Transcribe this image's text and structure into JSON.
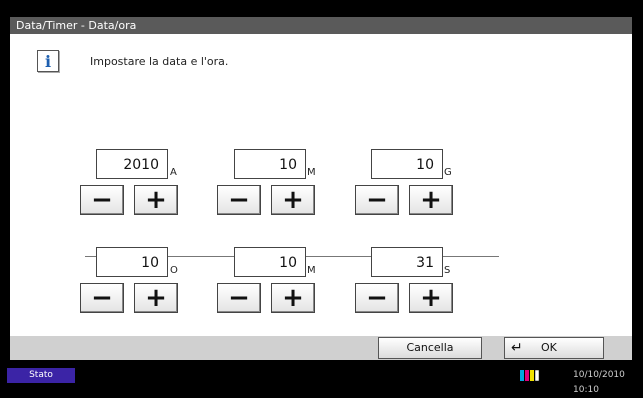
{
  "title": "Data/Timer - Data/ora",
  "message": "Impostare la data e l'ora.",
  "icons": {
    "info": "info-icon",
    "minus": "minus-icon",
    "plus": "plus-icon",
    "enter": "enter-arrow-icon",
    "toner": "toner-status-icon"
  },
  "glyphs": {
    "info": "i",
    "minus": "−",
    "plus": "+",
    "enter": "↵"
  },
  "date": {
    "year": {
      "value": "2010",
      "unit": "A"
    },
    "month": {
      "value": "10",
      "unit": "M"
    },
    "day": {
      "value": "10",
      "unit": "G"
    }
  },
  "time": {
    "hour": {
      "value": "10",
      "unit": "O"
    },
    "minute": {
      "value": "10",
      "unit": "M"
    },
    "second": {
      "value": "31",
      "unit": "S"
    }
  },
  "buttons": {
    "cancel": "Cancella",
    "ok": "OK"
  },
  "status": {
    "label": "Stato",
    "datetime": "10/10/2010  10:10"
  },
  "colors": {
    "titlebar": "#5a5a5a",
    "status_accent": "#3b24a6",
    "info_icon": "#1d5fb0",
    "toner": [
      "#00a8e0",
      "#e0007a",
      "#f0e000",
      "#111111"
    ]
  }
}
